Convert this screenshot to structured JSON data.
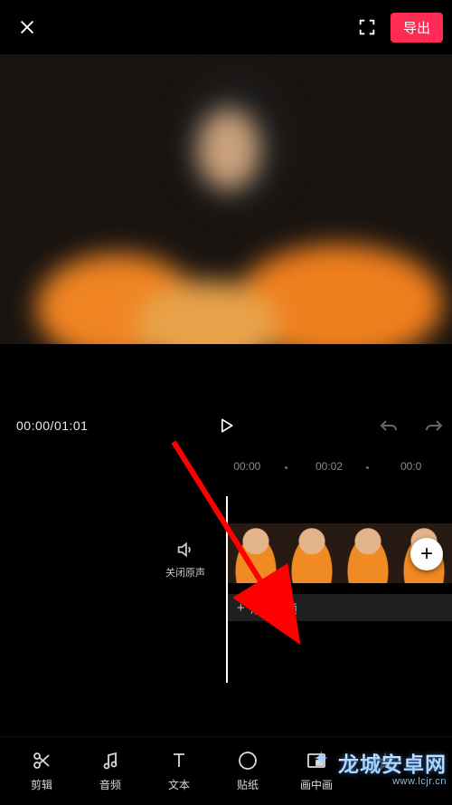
{
  "topbar": {
    "export_label": "导出"
  },
  "player": {
    "current_time": "00:00",
    "total_time": "01:01"
  },
  "ruler": {
    "ticks": [
      "00:00",
      "00:02",
      "00:0"
    ]
  },
  "tracks": {
    "mute_label": "关闭原声",
    "add_audio_label": "添加音频"
  },
  "toolbar": {
    "items": [
      {
        "id": "edit",
        "label": "剪辑"
      },
      {
        "id": "audio",
        "label": "音频"
      },
      {
        "id": "text",
        "label": "文本"
      },
      {
        "id": "sticker",
        "label": "贴纸"
      },
      {
        "id": "pip",
        "label": "画中画"
      }
    ]
  },
  "watermark": {
    "main": "龙城安卓网",
    "sub": "www.lcjr.cn"
  },
  "colors": {
    "accent": "#fe2c55",
    "annotation_arrow": "#ff0000"
  }
}
